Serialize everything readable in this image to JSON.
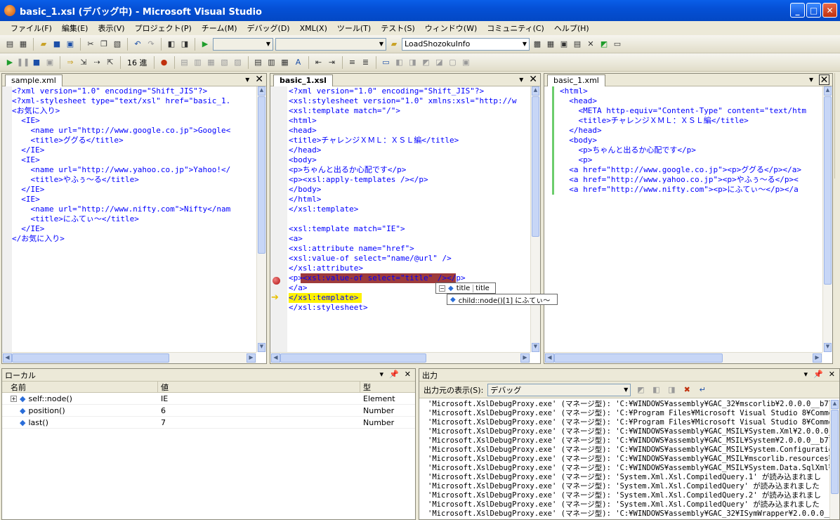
{
  "window": {
    "title": "basic_1.xsl (デバッグ中) - Microsoft Visual Studio"
  },
  "menu": [
    "ファイル(F)",
    "編集(E)",
    "表示(V)",
    "プロジェクト(P)",
    "チーム(M)",
    "デバッグ(D)",
    "XML(X)",
    "ツール(T)",
    "テスト(S)",
    "ウィンドウ(W)",
    "コミュニティ(C)",
    "ヘルプ(H)"
  ],
  "toolbar": {
    "combo_value": "LoadShozokuInfo",
    "hex_label": "16 進"
  },
  "editors": {
    "left": {
      "tab": "sample.xml",
      "lines": [
        "<?xml version=\"1.0\" encoding=\"Shift_JIS\"?>",
        "<?xml-stylesheet type=\"text/xsl\" href=\"basic_1.",
        "<お気に入り>",
        "  <IE>",
        "    <name url=\"http://www.google.co.jp\">Google<",
        "    <title>ググる</title>",
        "  </IE>",
        "  <IE>",
        "    <name url=\"http://www.yahoo.co.jp\">Yahoo!</",
        "    <title>やふぅ～る</title>",
        "  </IE>",
        "  <IE>",
        "    <name url=\"http://www.nifty.com\">Nifty</nam",
        "    <title>にふてぃ～</title>",
        "  </IE>",
        "</お気に入り>"
      ]
    },
    "middle": {
      "tab": "basic_1.xsl",
      "lines": [
        "<?xml version=\"1.0\" encoding=\"Shift_JIS\"?>",
        "<xsl:stylesheet version=\"1.0\" xmlns:xsl=\"http://w",
        "<xsl:template match=\"/\">",
        "<html>",
        "<head>",
        "<title>チャレンジＸＭＬ：ＸＳＬ編</title>",
        "</head>",
        "<body>",
        "<p>ちゃんと出るか心配です</p>",
        "<p><xsl:apply-templates /></p>",
        "</body>",
        "</html>",
        "</xsl:template>",
        "",
        "<xsl:template match=\"IE\">",
        "<a>",
        "<xsl:attribute name=\"href\">",
        "<xsl:value-of select=\"name/@url\" />",
        "</xsl:attribute>",
        "<p><xsl:value-of select=\"title\" /></p>",
        "</a>",
        "</xsl:template>",
        "</xsl:stylesheet>"
      ]
    },
    "right": {
      "tab": "basic_1.xml",
      "lines": [
        "<html>",
        "  <head>",
        "    <META http-equiv=\"Content-Type\" content=\"text/htm",
        "    <title>チャレンジＸＭＬ：ＸＳＬ編</title>",
        "  </head>",
        "  <body>",
        "    <p>ちゃんと出るか心配です</p>",
        "    <p>",
        "  <a href=\"http://www.google.co.jp\"><p>ググる</p></a>",
        "  <a href=\"http://www.yahoo.co.jp\"><p>やふぅ～る</p><",
        "  <a href=\"http://www.nifty.com\"><p>にふてぃ～</p></a"
      ]
    }
  },
  "tooltip": {
    "row1_name": "title",
    "row1_value": "title",
    "row2": "child::node()[1]  にふてぃ～"
  },
  "locals": {
    "title": "ローカル",
    "headers": [
      "名前",
      "値",
      "型"
    ],
    "rows": [
      {
        "name": "self::node()",
        "value": "IE",
        "type": "Element"
      },
      {
        "name": "position()",
        "value": "6",
        "type": "Number"
      },
      {
        "name": "last()",
        "value": "7",
        "type": "Number"
      }
    ]
  },
  "output": {
    "title": "出力",
    "source_label": "出力元の表示(S):",
    "source_value": "デバッグ",
    "lines": [
      "'Microsoft.XslDebugProxy.exe' (マネージ型): 'C:¥WINDOWS¥assembly¥GAC_32¥mscorlib¥2.0.0.0__b77a",
      "'Microsoft.XslDebugProxy.exe' (マネージ型): 'C:¥Program Files¥Microsoft Visual Studio 8¥Common",
      "'Microsoft.XslDebugProxy.exe' (マネージ型): 'C:¥Program Files¥Microsoft Visual Studio 8¥Common",
      "'Microsoft.XslDebugProxy.exe' (マネージ型): 'C:¥WINDOWS¥assembly¥GAC_MSIL¥System.Xml¥2.0.0.0__",
      "'Microsoft.XslDebugProxy.exe' (マネージ型): 'C:¥WINDOWS¥assembly¥GAC_MSIL¥System¥2.0.0.0__b77a",
      "'Microsoft.XslDebugProxy.exe' (マネージ型): 'C:¥WINDOWS¥assembly¥GAC_MSIL¥System.Configuration",
      "'Microsoft.XslDebugProxy.exe' (マネージ型): 'C:¥WINDOWS¥assembly¥GAC_MSIL¥mscorlib.resources¥2",
      "'Microsoft.XslDebugProxy.exe' (マネージ型): 'C:¥WINDOWS¥assembly¥GAC_MSIL¥System.Data.SqlXml¥2",
      "'Microsoft.XslDebugProxy.exe' (マネージ型): 'System.Xml.Xsl.CompiledQuery.1' が読み込まれまし",
      "'Microsoft.XslDebugProxy.exe' (マネージ型): 'System.Xml.Xsl.CompiledQuery' が読み込まれました",
      "'Microsoft.XslDebugProxy.exe' (マネージ型): 'System.Xml.Xsl.CompiledQuery.2' が読み込まれまし",
      "'Microsoft.XslDebugProxy.exe' (マネージ型): 'System.Xml.Xsl.CompiledQuery' が読み込まれました",
      "'Microsoft.XslDebugProxy.exe' (マネージ型): 'C:¥WINDOWS¥assembly¥GAC_32¥ISymWrapper¥2.0.0.0__b"
    ]
  }
}
